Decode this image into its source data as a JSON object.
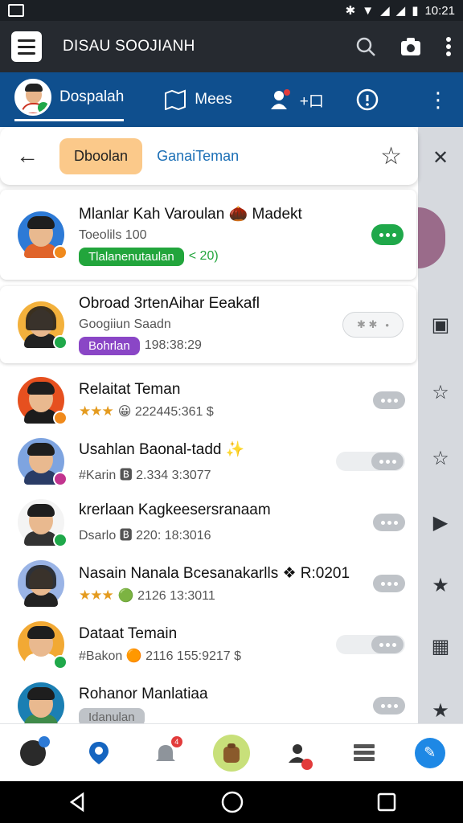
{
  "statusbar": {
    "time": "10:21"
  },
  "appbar": {
    "title": "DISAU SOOJIANH"
  },
  "tabs": [
    {
      "label": "Dospalah"
    },
    {
      "label": "Mees"
    },
    {
      "label": "+口"
    }
  ],
  "panel": {
    "filter_chip": "Dboolan",
    "head_link": "GanaiTeman"
  },
  "cards": [
    {
      "name": "Mlanlar Kah Varoulan 🌰 Madekt",
      "sub": "Toeolils 100",
      "tag": "Tlalanenutaulan",
      "tag_color": "#22a53c",
      "extra": "< 20)"
    },
    {
      "name": "Obroad 3rtenAihar Eeakafl",
      "sub": "Googiiun Saadn",
      "tag": "Bohrlan",
      "tag_color": "#8a46c6",
      "extra": "198:38:29"
    }
  ],
  "friends": [
    {
      "name": "Relaitat Teman",
      "stars": "★★★",
      "meta": "😀 222445:361 $"
    },
    {
      "name": "Usahlan Baonal-tadd ✨",
      "stars": "",
      "meta": "#Karin  🅱 2.334 3:3077"
    },
    {
      "name": "krerlaan Kagkeesersranaam",
      "stars": "",
      "meta": "Dsarlo  🅱 220: 18:3016"
    },
    {
      "name": "Nasain Nanala Bcesanakarlls ❖ R:0201",
      "stars": "★★★",
      "meta": "🟢 2126 13:3011"
    },
    {
      "name": "Dataat Temain",
      "stars": "",
      "meta": "#Bakon  🟠 2116 155:9217 $"
    },
    {
      "name": "Rohanor Manlatiaa",
      "stars": "",
      "meta": "Idanulan"
    }
  ],
  "colors": {
    "appbar": "#262a30",
    "tabbar": "#0f4f8e",
    "accent_green": "#1fa84a",
    "chip_orange": "#fbc98a"
  }
}
